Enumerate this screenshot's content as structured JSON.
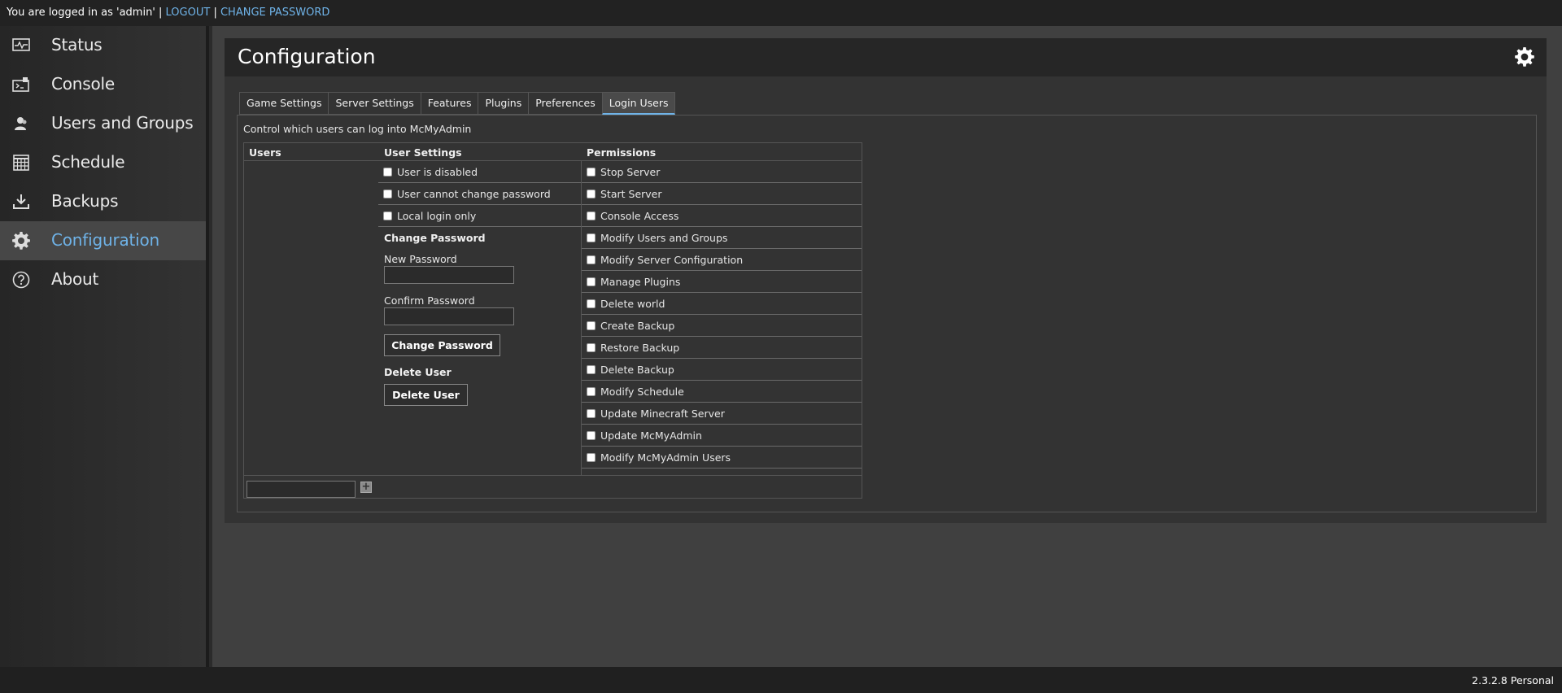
{
  "topbar": {
    "logged_in_text": "You are logged in as 'admin' | ",
    "logout": "LOGOUT",
    "separator": " | ",
    "change_password": "CHANGE PASSWORD"
  },
  "sidebar": {
    "items": [
      {
        "label": "Status",
        "icon": "pulse-monitor-icon"
      },
      {
        "label": "Console",
        "icon": "console-icon"
      },
      {
        "label": "Users and Groups",
        "icon": "users-icon"
      },
      {
        "label": "Schedule",
        "icon": "calendar-grid-icon"
      },
      {
        "label": "Backups",
        "icon": "download-tray-icon"
      },
      {
        "label": "Configuration",
        "icon": "gear-icon",
        "active": true
      },
      {
        "label": "About",
        "icon": "question-circle-icon"
      }
    ]
  },
  "panel": {
    "title": "Configuration",
    "tabs": [
      "Game Settings",
      "Server Settings",
      "Features",
      "Plugins",
      "Preferences",
      "Login Users"
    ],
    "active_tab": "Login Users",
    "description": "Control which users can log into McMyAdmin"
  },
  "table": {
    "headers": {
      "users": "Users",
      "user_settings": "User Settings",
      "permissions": "Permissions"
    },
    "user_settings": [
      "User is disabled",
      "User cannot change password",
      "Local login only"
    ],
    "change_password": {
      "title": "Change Password",
      "new_label": "New Password",
      "confirm_label": "Confirm Password",
      "new_value": "",
      "confirm_value": "",
      "button": "Change Password"
    },
    "delete_user": {
      "title": "Delete User",
      "button": "Delete User"
    },
    "permissions": [
      "Stop Server",
      "Start Server",
      "Console Access",
      "Modify Users and Groups",
      "Modify Server Configuration",
      "Manage Plugins",
      "Delete world",
      "Create Backup",
      "Restore Backup",
      "Delete Backup",
      "Modify Schedule",
      "Update Minecraft Server",
      "Update McMyAdmin",
      "Modify McMyAdmin Users"
    ],
    "new_user_value": "",
    "add_symbol": "+"
  },
  "footer": {
    "version": "2.3.2.8 Personal"
  },
  "colors": {
    "accent": "#6fb3e8",
    "background": "#404040",
    "panel": "#333333",
    "header": "#262626"
  }
}
